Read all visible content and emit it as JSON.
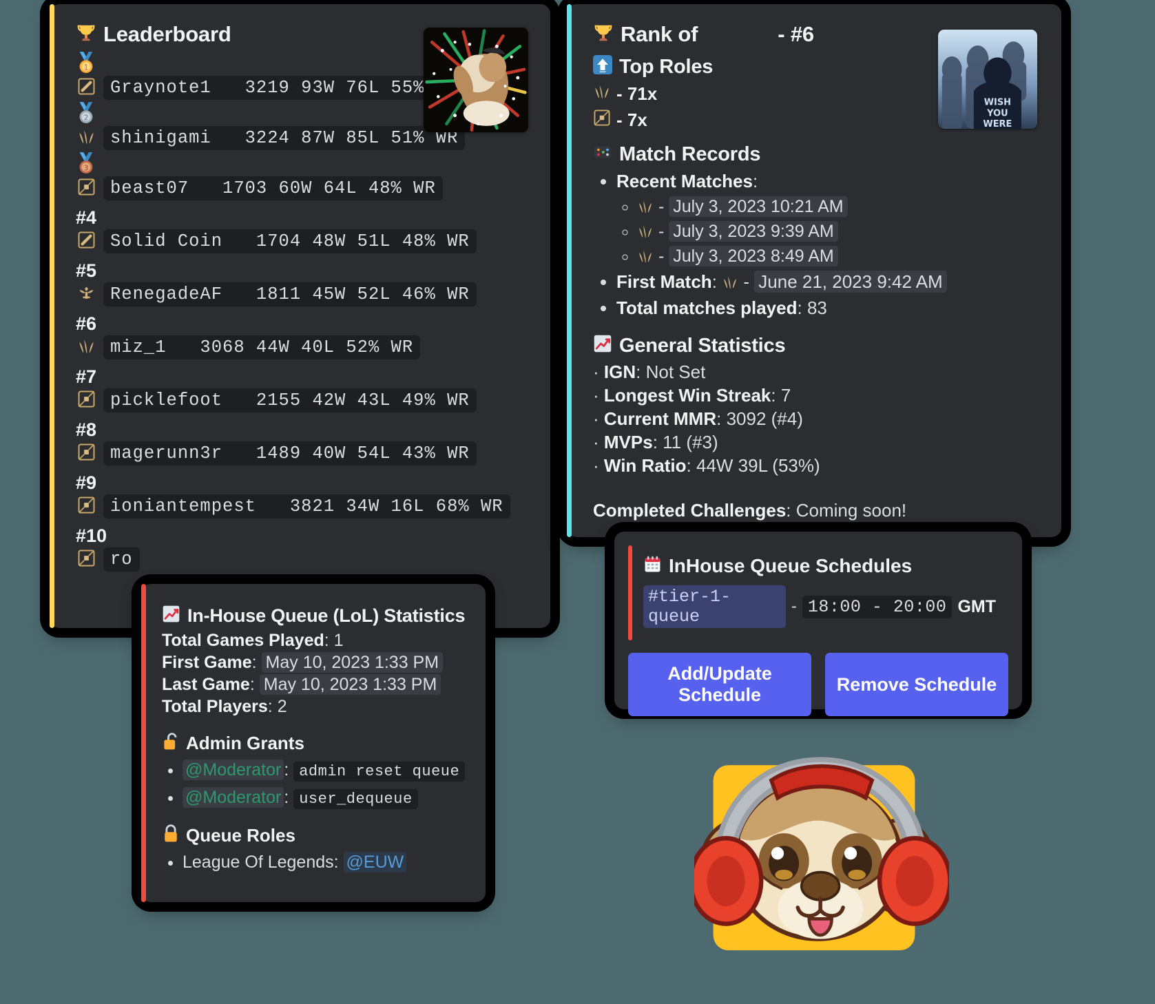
{
  "leaderboard": {
    "title": "Leaderboard",
    "title_icon": "trophy-icon",
    "entries": [
      {
        "rank_label": "1",
        "rank_icon": "gold-medal-icon",
        "role_icon": "top-lane-icon",
        "text": "Graynote1   3219 93W 76L 55% WR"
      },
      {
        "rank_label": "2",
        "rank_icon": "silver-medal-icon",
        "role_icon": "jungle-icon",
        "text": "shinigami   3224 87W 85L 51% WR"
      },
      {
        "rank_label": "3",
        "rank_icon": "bronze-medal-icon",
        "role_icon": "bottom-lane-icon",
        "text": "beast07   1703 60W 64L 48% WR"
      },
      {
        "rank_label": "#4",
        "rank_icon": "",
        "role_icon": "top-lane-icon",
        "text": "Solid Coin   1704 48W 51L 48% WR"
      },
      {
        "rank_label": "#5",
        "rank_icon": "",
        "role_icon": "support-icon",
        "text": "RenegadeAF   1811 45W 52L 46% WR"
      },
      {
        "rank_label": "#6",
        "rank_icon": "",
        "role_icon": "jungle-icon",
        "text": "miz_1   3068 44W 40L 52% WR"
      },
      {
        "rank_label": "#7",
        "rank_icon": "",
        "role_icon": "bottom-lane-icon",
        "text": "picklefoot   2155 42W 43L 49% WR"
      },
      {
        "rank_label": "#8",
        "rank_icon": "",
        "role_icon": "bottom-lane-icon",
        "text": "magerunn3r   1489 40W 54L 43% WR"
      },
      {
        "rank_label": "#9",
        "rank_icon": "",
        "role_icon": "bottom-lane-icon",
        "text": "ioniantempest   3821 34W 16L 68% WR"
      },
      {
        "rank_label": "#10",
        "rank_icon": "",
        "role_icon": "bottom-lane-icon",
        "text": "ro"
      }
    ]
  },
  "rank_card": {
    "title_icon": "trophy-icon",
    "title_prefix": "Rank of",
    "title_user": "",
    "title_rank": "- #6",
    "top_roles": {
      "icon": "up-arrow-icon",
      "heading": "Top Roles",
      "rows": [
        {
          "icon": "jungle-icon",
          "label": "- 71x"
        },
        {
          "icon": "bottom-lane-icon",
          "label": "- 7x"
        }
      ]
    },
    "match_records": {
      "icon": "game-die-icon",
      "heading": "Match Records",
      "recent_label": "Recent Matches",
      "recent": [
        {
          "icon": "jungle-icon",
          "sep": "-",
          "time": "July 3, 2023 10:21 AM"
        },
        {
          "icon": "jungle-icon",
          "sep": "-",
          "time": "July 3, 2023 9:39 AM"
        },
        {
          "icon": "jungle-icon",
          "sep": "-",
          "time": "July 3, 2023 8:49 AM"
        }
      ],
      "first_match_label": "First Match",
      "first_match_icon": "jungle-icon",
      "first_match_sep": "-",
      "first_match_time": "June 21, 2023 9:42 AM",
      "total_label": "Total matches played",
      "total_value": "83"
    },
    "general_statistics": {
      "icon": "chart-increasing-icon",
      "heading": "General Statistics",
      "rows": [
        {
          "label": "IGN",
          "value": "Not Set"
        },
        {
          "label": "Longest Win Streak",
          "value": "7"
        },
        {
          "label": "Current MMR",
          "value": "3092 (#4)"
        },
        {
          "label": "MVPs",
          "value": "11 (#3)"
        },
        {
          "label": "Win Ratio",
          "value": "44W 39L (53%)"
        }
      ]
    },
    "challenges_label": "Completed Challenges",
    "challenges_value": "Coming soon!"
  },
  "queue_stats": {
    "icon": "chart-increasing-icon",
    "title": "In-House Queue (LoL) Statistics",
    "rows": [
      {
        "label": "Total Games Played",
        "value": "1",
        "highlight": false
      },
      {
        "label": "First Game",
        "value": "May 10, 2023 1:33 PM",
        "highlight": true
      },
      {
        "label": "Last Game",
        "value": "May 10, 2023 1:33 PM",
        "highlight": true
      },
      {
        "label": "Total Players",
        "value": "2",
        "highlight": false
      }
    ],
    "admin_grants": {
      "icon": "unlocked-icon",
      "heading": "Admin Grants",
      "items": [
        {
          "role": "@Moderator",
          "command": "admin reset queue"
        },
        {
          "role": "@Moderator",
          "command": "user_dequeue"
        }
      ]
    },
    "queue_roles": {
      "icon": "locked-icon",
      "heading": "Queue Roles",
      "items": [
        {
          "game": "League Of Legends",
          "role": "@EUW"
        }
      ]
    }
  },
  "schedules": {
    "icon": "calendar-icon",
    "title": "InHouse Queue Schedules",
    "channel": "#tier-1-queue",
    "separator": "-",
    "time_range": "18:00 - 20:00",
    "timezone": "GMT",
    "buttons": [
      {
        "label": "Add/Update Schedule"
      },
      {
        "label": "Remove Schedule"
      }
    ]
  },
  "colors": {
    "background": "#4d6a70",
    "card_bg": "#2b2d31",
    "leaderboard_accent": "#ffd85e",
    "rank_accent": "#5de4ea",
    "queue_accent": "#f04b3c",
    "button_blurple": "#5661f0"
  },
  "thumbnails": {
    "leaderboard_thumb": "fireworks-portrait-thumbnail",
    "rank_thumb": "wish-you-were-here-thumbnail",
    "mascot": "dog-with-headphones-logo"
  }
}
